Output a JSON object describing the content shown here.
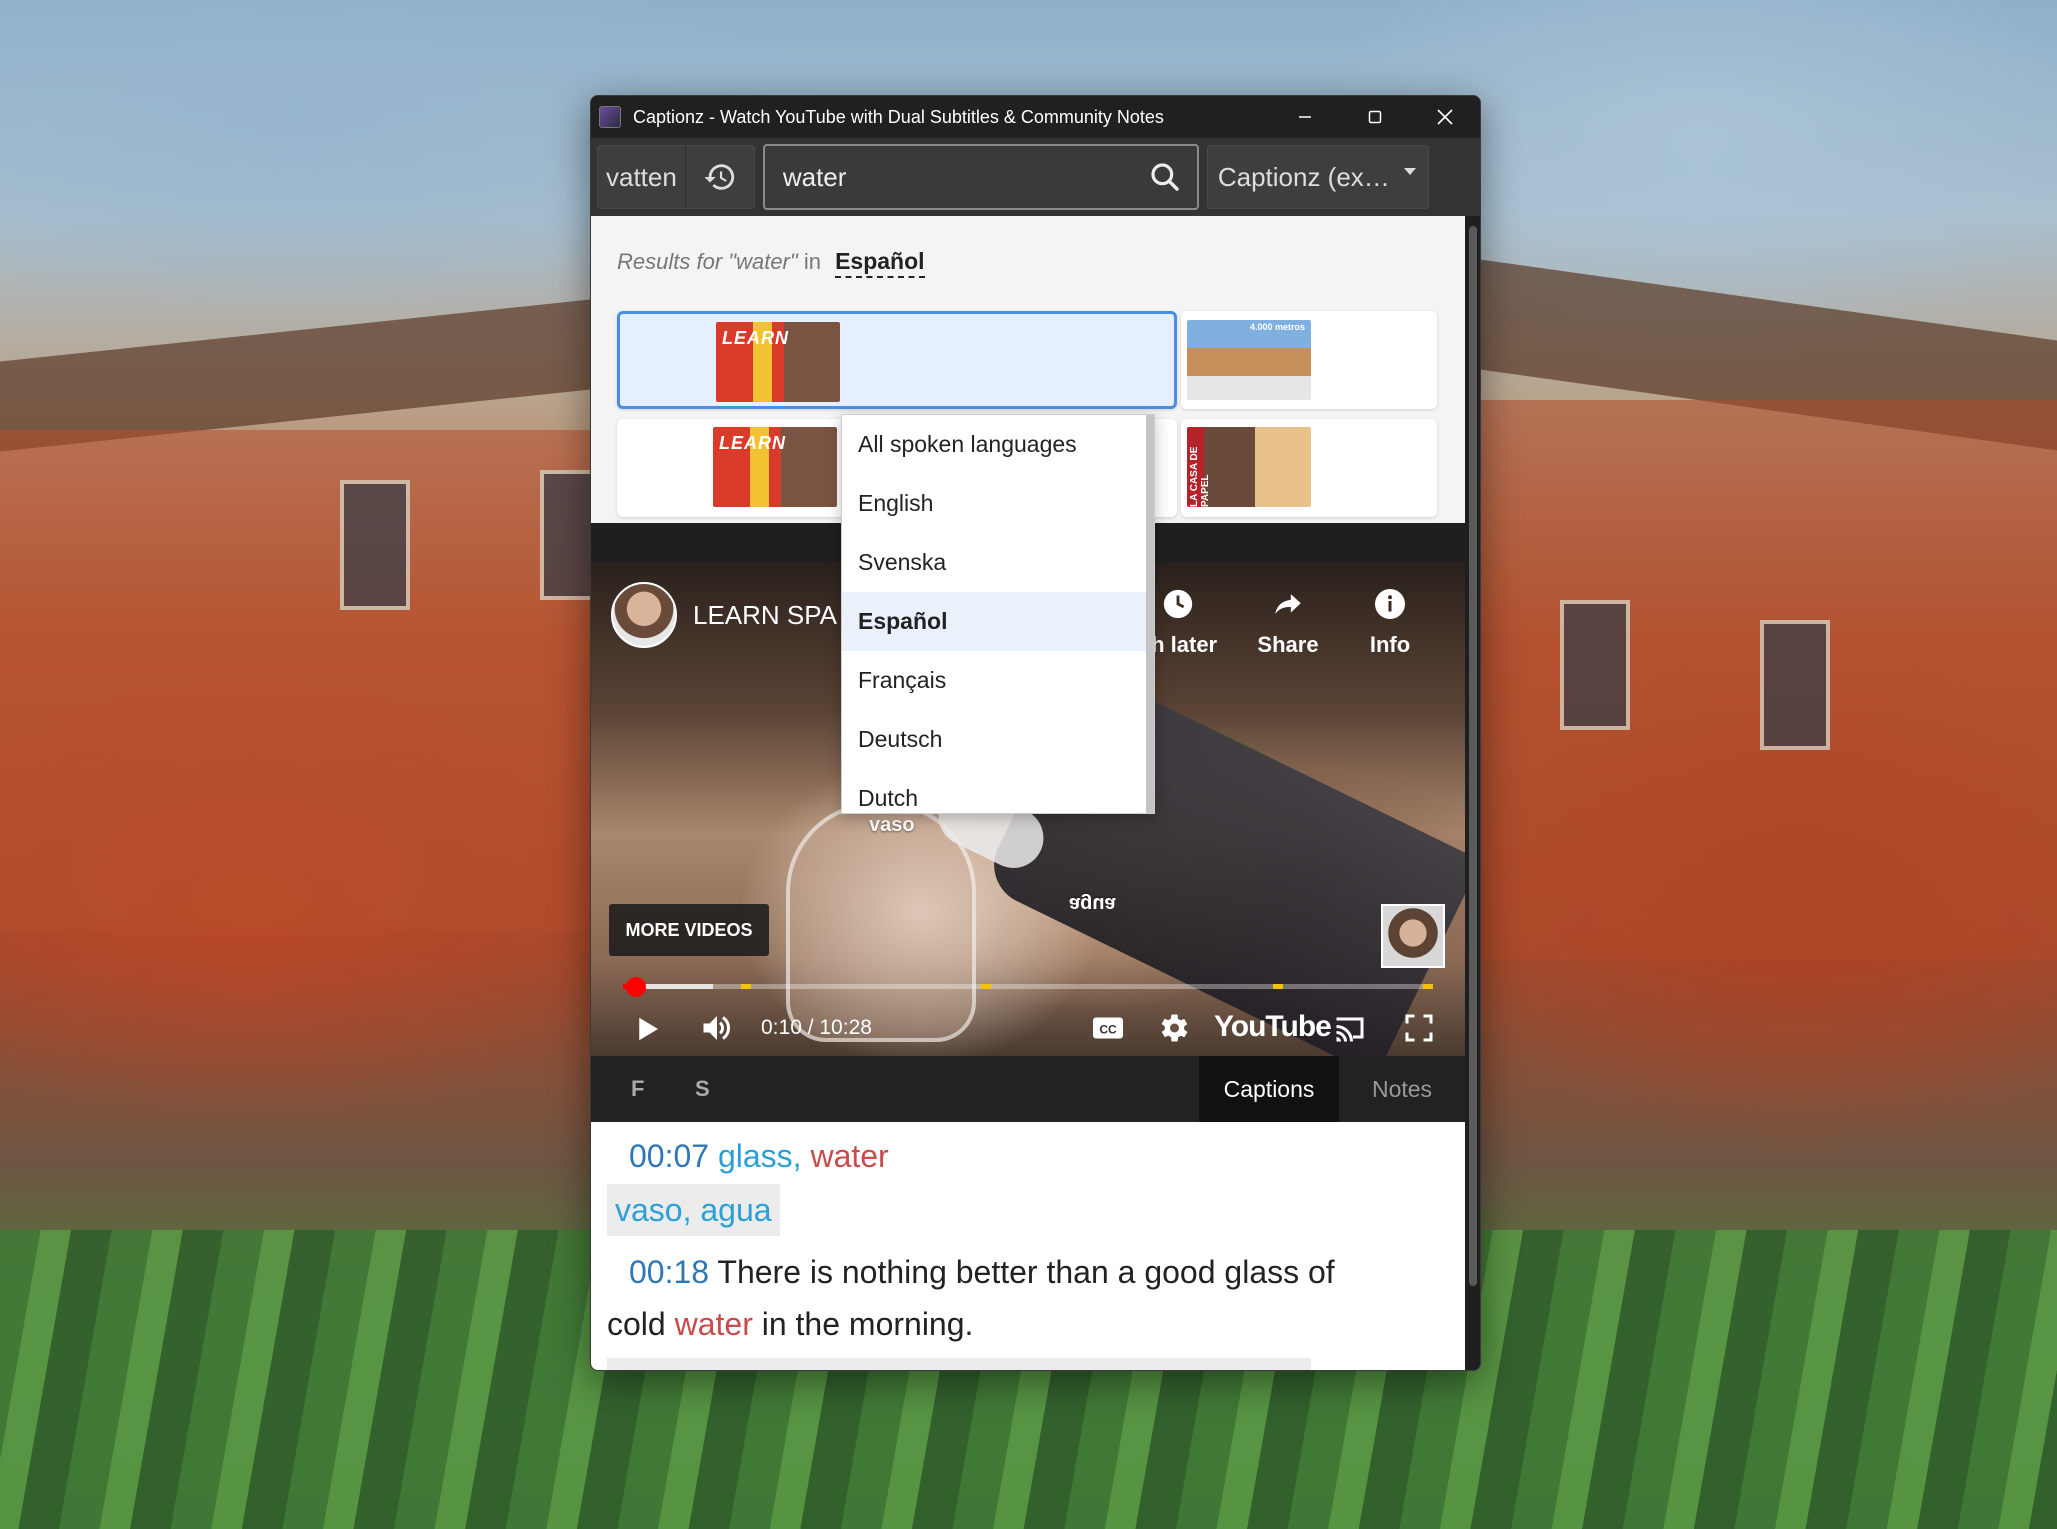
{
  "window": {
    "title": "Captionz - Watch YouTube with Dual Subtitles & Community Notes",
    "controls": [
      "minimize",
      "maximize",
      "close"
    ]
  },
  "toolbar": {
    "previous_query": "vatten",
    "search_value": "water",
    "source_select": "Captionz (ex…"
  },
  "results": {
    "label_prefix": "Results for",
    "label_query": "\"water\"",
    "label_in": "in",
    "selected_language": "Español"
  },
  "language_dropdown": {
    "items": [
      "All spoken languages",
      "English",
      "Svenska",
      "Español",
      "Français",
      "Deutsch",
      "Dutch"
    ],
    "active": "Español"
  },
  "result_thumbnails": [
    {
      "text": "LEARN"
    },
    {
      "text": "4.000 metros"
    },
    {
      "text": "LEARN"
    },
    {
      "text": "LA CASA DE PAPEL"
    }
  ],
  "player": {
    "channel_name": "LEARN SPA",
    "actions": [
      {
        "label": "ch later",
        "icon": "clock-icon"
      },
      {
        "label": "Share",
        "icon": "share-icon"
      },
      {
        "label": "Info",
        "icon": "info-icon"
      }
    ],
    "word_labels": [
      "vaso",
      "agua"
    ],
    "more_videos": "MORE VIDEOS",
    "time": "0:10 / 10:28",
    "progress": 0.016,
    "brand": "YouTube"
  },
  "panel_tabs": {
    "left": [
      "F",
      "S"
    ],
    "captions": "Captions",
    "notes": "Notes"
  },
  "captions": {
    "line1": {
      "time": "00:07",
      "w1": "glass,",
      "w2": "water"
    },
    "line1_translation": "vaso, agua",
    "line2": {
      "time": "00:18",
      "text_a": "There is nothing better than a good glass of",
      "text_b": "cold",
      "word": "water",
      "text_c": "in the morning."
    }
  }
}
